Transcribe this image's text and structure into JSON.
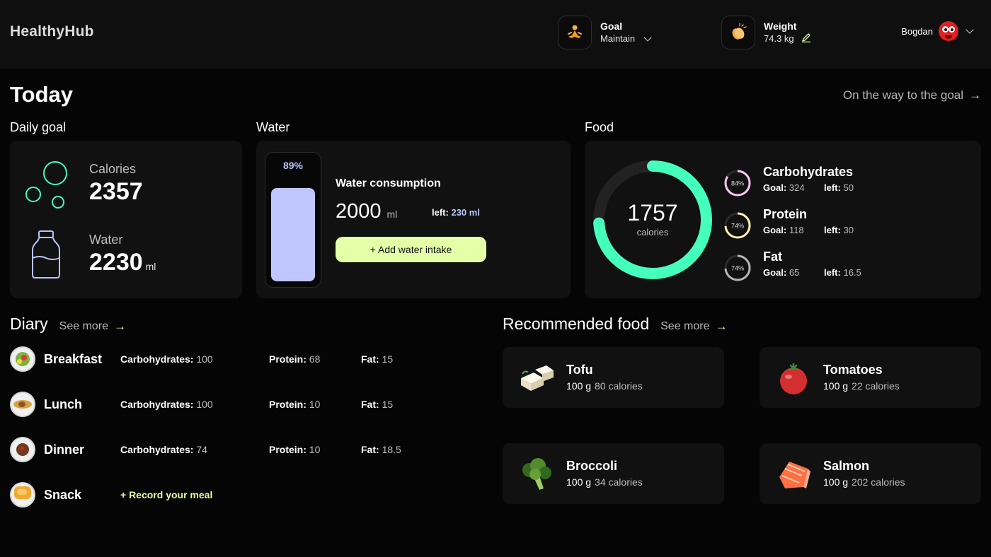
{
  "header": {
    "logo": "HealthyHub",
    "goal": {
      "label": "Goal",
      "value": "Maintain",
      "icon": "meditation-icon"
    },
    "weight": {
      "label": "Weight",
      "value": "74.3 kg",
      "icon": "clapping-hands-icon"
    },
    "user": {
      "name": "Bogdan",
      "avatar": "red-face-avatar"
    }
  },
  "page": {
    "title": "Today",
    "goal_link": "On the way to the goal"
  },
  "daily_goal": {
    "label": "Daily goal",
    "calories_label": "Calories",
    "calories_value": "2357",
    "water_label": "Water",
    "water_value": "2230",
    "water_unit": "ml"
  },
  "water": {
    "label": "Water",
    "percent_text": "89%",
    "fill_fraction": 0.89,
    "title": "Water consumption",
    "amount": "2000",
    "unit": "ml",
    "left_label": "left:",
    "left_value": "230 ml",
    "add_button": "+ Add water intake",
    "fill_color": "#c0c6ff"
  },
  "food": {
    "label": "Food",
    "calories": "1757",
    "calories_label": "calories",
    "ring_fraction": 0.74,
    "ring_color": "#45ffbc",
    "macros": [
      {
        "name": "Carbohydrates",
        "percent": "84%",
        "fraction": 0.84,
        "color": "#ffc4f7",
        "goal_label": "Goal:",
        "goal": "324",
        "left_label": "left:",
        "left": "50"
      },
      {
        "name": "Protein",
        "percent": "74%",
        "fraction": 0.74,
        "color": "#fff3b7",
        "goal_label": "Goal:",
        "goal": "118",
        "left_label": "left:",
        "left": "30"
      },
      {
        "name": "Fat",
        "percent": "74%",
        "fraction": 0.74,
        "color": "#b6b6b6",
        "goal_label": "Goal:",
        "goal": "65",
        "left_label": "left:",
        "left": "16.5"
      }
    ]
  },
  "diary": {
    "title": "Diary",
    "see_more": "See more",
    "rows": [
      {
        "meal": "Breakfast",
        "carb_label": "Carbohydrates:",
        "carb": "100",
        "protein_label": "Protein:",
        "protein": "68",
        "fat_label": "Fat:",
        "fat": "15"
      },
      {
        "meal": "Lunch",
        "carb_label": "Carbohydrates:",
        "carb": "100",
        "protein_label": "Protein:",
        "protein": "10",
        "fat_label": "Fat:",
        "fat": "15"
      },
      {
        "meal": "Dinner",
        "carb_label": "Carbohydrates:",
        "carb": "74",
        "protein_label": "Protein:",
        "protein": "10",
        "fat_label": "Fat:",
        "fat": "18.5"
      },
      {
        "meal": "Snack",
        "record": "+ Record your meal"
      }
    ]
  },
  "recommended": {
    "title": "Recommended food",
    "see_more": "See more",
    "items": [
      {
        "name": "Tofu",
        "amount": "100 g",
        "calories": "80 calories",
        "icon": "tofu-icon"
      },
      {
        "name": "Tomatoes",
        "amount": "100 g",
        "calories": "22 calories",
        "icon": "tomato-icon"
      },
      {
        "name": "Broccoli",
        "amount": "100 g",
        "calories": "34 calories",
        "icon": "broccoli-icon"
      },
      {
        "name": "Salmon",
        "amount": "100 g",
        "calories": "202 calories",
        "icon": "salmon-icon"
      }
    ]
  },
  "colors": {
    "accent_lime": "#e3ffa8",
    "accent_green": "#45ffbc",
    "accent_blue": "#b8c4ff"
  }
}
